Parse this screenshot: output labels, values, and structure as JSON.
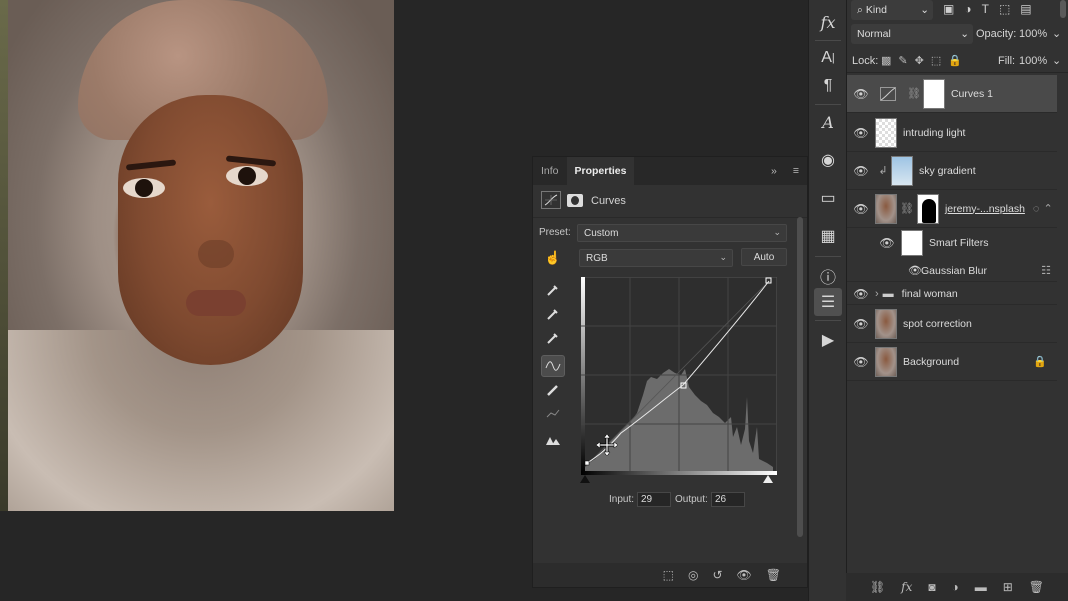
{
  "properties": {
    "tabs": [
      {
        "label": "Info"
      },
      {
        "label": "Properties"
      }
    ],
    "header_label": "Curves",
    "preset_label": "Preset:",
    "preset_value": "Custom",
    "channel_value": "RGB",
    "auto_label": "Auto",
    "input_label": "Input:",
    "input_value": "29",
    "output_label": "Output:",
    "output_value": "26"
  },
  "layers_panel": {
    "filter_kind": "Kind",
    "blend_mode": "Normal",
    "opacity_label": "Opacity:",
    "opacity_value": "100%",
    "lock_label": "Lock:",
    "fill_label": "Fill:",
    "fill_value": "100%",
    "layers": [
      {
        "name": "Curves 1"
      },
      {
        "name": "intruding light"
      },
      {
        "name": "sky gradient"
      },
      {
        "name": "jeremy-...nsplash"
      },
      {
        "name": "Smart Filters"
      },
      {
        "name": "Gaussian Blur"
      },
      {
        "name": "final woman"
      },
      {
        "name": "spot correction"
      },
      {
        "name": "Background"
      }
    ]
  },
  "icons": {
    "fx": "fx",
    "menu": "≡",
    "collapse": "»"
  },
  "colors": {
    "panel_bg": "#323232",
    "selected_row": "#4a4a4a",
    "canvas_bg": "#262626"
  }
}
